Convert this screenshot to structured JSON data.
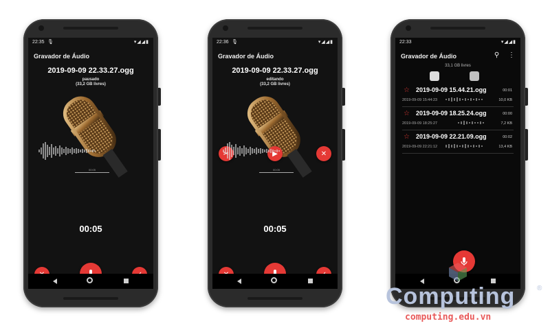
{
  "colors": {
    "accent": "#e53935",
    "screen_bg": "#121212",
    "text": "#ffffff"
  },
  "phones": [
    {
      "status": {
        "time": "22:35"
      },
      "app_title": "Gravador de Áudio",
      "file_name": "2019-09-09 22.33.27.ogg",
      "state": "pausado",
      "free": "(33,2 GB livres)",
      "timeline_label": "00:05",
      "timer": "00:05",
      "buttons": [
        "close-icon",
        "mic-icon",
        "check-icon"
      ]
    },
    {
      "status": {
        "time": "22:36"
      },
      "app_title": "Gravador de Áudio",
      "file_name": "2019-09-09 22.33.27.ogg",
      "state": "editando",
      "free": "(33,2 GB livres)",
      "timeline_label": "00:05",
      "timer": "00:05",
      "buttons": [
        "cut-icon",
        "play-icon",
        "close-icon",
        "close-icon",
        "mic-icon",
        "check-icon"
      ]
    },
    {
      "status": {
        "time": "22:33"
      },
      "app_title": "Gravador de Áudio",
      "free_space": "33,1 GB livres",
      "recordings": [
        {
          "name": "2019-09-09 15.44.21.ogg",
          "duration": "00:01",
          "date": "2019-09-09 15:44:23",
          "size": "10,0 KB"
        },
        {
          "name": "2019-09-09 18.25.24.ogg",
          "duration": "00:00",
          "date": "2019-09-09 18:25:27",
          "size": "7,2 KB"
        },
        {
          "name": "2019-09-09 22.21.09.ogg",
          "duration": "00:02",
          "date": "2019-09-09 22:21:12",
          "size": "13,4 KB"
        }
      ]
    }
  ],
  "watermark": {
    "logo": "Computing",
    "url": "computing.edu.vn",
    "reg": "®"
  }
}
